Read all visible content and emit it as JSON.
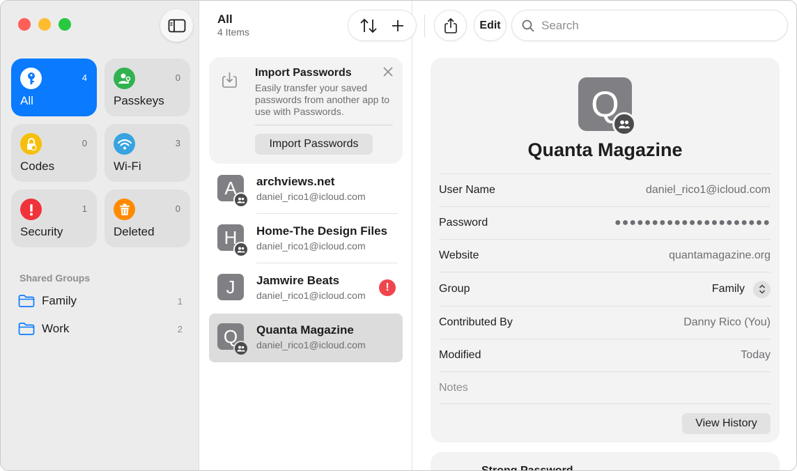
{
  "sidebar": {
    "tiles": [
      {
        "label": "All",
        "count": "4",
        "icon": "key-icon",
        "color": "#0a7aff"
      },
      {
        "label": "Passkeys",
        "count": "0",
        "icon": "person-key-icon",
        "color": "#30b34f"
      },
      {
        "label": "Codes",
        "count": "0",
        "icon": "lock-clock-icon",
        "color": "#f6c00a"
      },
      {
        "label": "Wi-Fi",
        "count": "3",
        "icon": "wifi-icon",
        "color": "#38a3e0"
      },
      {
        "label": "Security",
        "count": "1",
        "icon": "exclamation-icon",
        "color": "#f0333b"
      },
      {
        "label": "Deleted",
        "count": "0",
        "icon": "trash-icon",
        "color": "#ff8a00"
      }
    ],
    "section_title": "Shared Groups",
    "groups": [
      {
        "label": "Family",
        "count": "1"
      },
      {
        "label": "Work",
        "count": "2"
      }
    ]
  },
  "list": {
    "title": "All",
    "subtitle": "4 Items",
    "import_card": {
      "title": "Import Passwords",
      "body": "Easily transfer your saved passwords from another app to use with Passwords.",
      "button": "Import Passwords"
    },
    "entries": [
      {
        "initial": "A",
        "title": "archviews.net",
        "subtitle": "daniel_rico1@icloud.com"
      },
      {
        "initial": "H",
        "title": "Home-The Design Files",
        "subtitle": "daniel_rico1@icloud.com"
      },
      {
        "initial": "J",
        "title": "Jamwire Beats",
        "subtitle": "daniel_rico1@icloud.com"
      },
      {
        "initial": "Q",
        "title": "Quanta Magazine",
        "subtitle": "daniel_rico1@icloud.com"
      }
    ]
  },
  "toolbar": {
    "edit_label": "Edit",
    "search_placeholder": "Search"
  },
  "detail": {
    "initial": "Q",
    "title": "Quanta Magazine",
    "fields": {
      "username": {
        "label": "User Name",
        "value": "daniel_rico1@icloud.com"
      },
      "password": {
        "label": "Password",
        "value": "●●●●●●●●●●●●●●●●●●●●●"
      },
      "website": {
        "label": "Website",
        "value": "quantamagazine.org"
      },
      "group": {
        "label": "Group",
        "value": "Family"
      },
      "contributed": {
        "label": "Contributed By",
        "value": "Danny Rico (You)"
      },
      "modified": {
        "label": "Modified",
        "value": "Today"
      },
      "notes": {
        "label": "Notes"
      }
    },
    "history_button": "View History",
    "next_section_title": "Strong Password"
  }
}
